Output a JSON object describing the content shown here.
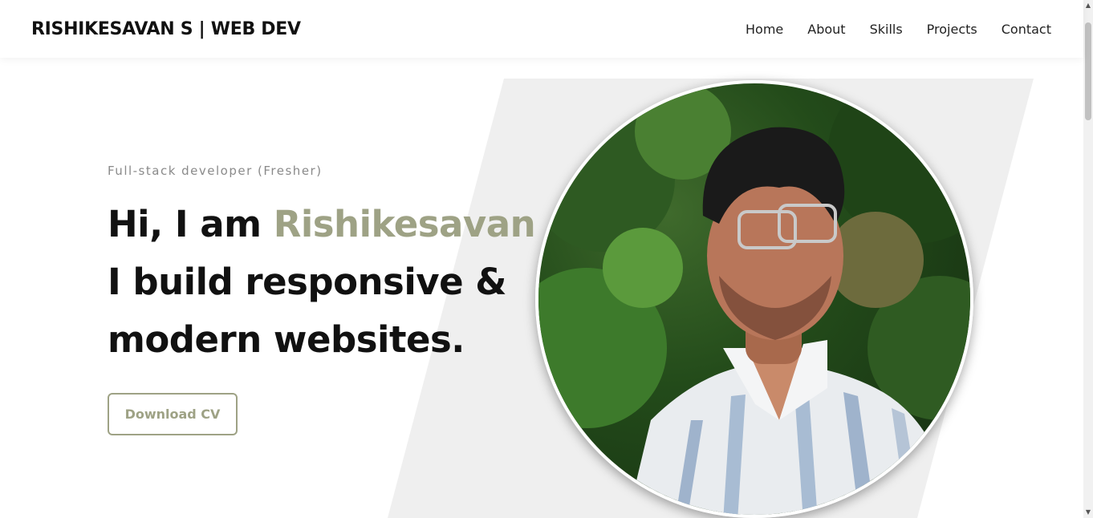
{
  "navbar": {
    "brand": "RISHIKESAVAN S | WEB DEV",
    "links": [
      "Home",
      "About",
      "Skills",
      "Projects",
      "Contact"
    ]
  },
  "hero": {
    "subtitle": "Full-stack developer (Fresher)",
    "greeting": "Hi, I am ",
    "name": "Rishikesavan",
    "line2": "I build responsive &",
    "line3": "modern websites.",
    "cv_button": "Download CV"
  },
  "colors": {
    "accent": "#9ea285",
    "background_shape": "#efefef",
    "text": "#111111"
  }
}
